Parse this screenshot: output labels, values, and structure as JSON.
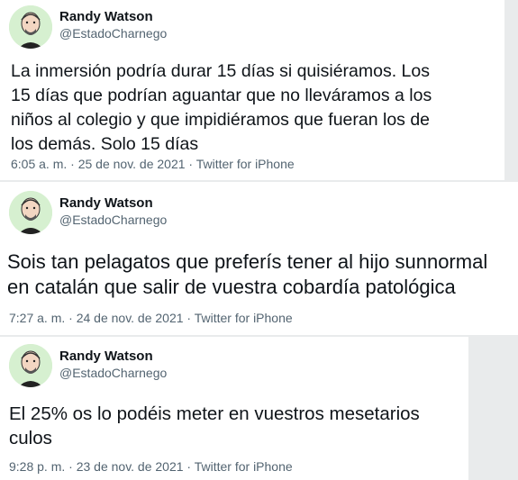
{
  "tweets": [
    {
      "author_name": "Randy Watson",
      "handle": "@EstadoCharnego",
      "text": "La inmersión podría durar 15 días si quisiéramos. Los\n15 días que podrían aguantar que no lleváramos a los\nniños al colegio y que impidiéramos que fueran los de\nlos demás. Solo 15 días",
      "meta": "6:05 a. m. · 25 de nov. de 2021 · Twitter for iPhone"
    },
    {
      "author_name": "Randy Watson",
      "handle": "@EstadoCharnego",
      "text": "Sois tan pelagatos que preferís tener al hijo sunnormal\nen catalán que salir de vuestra cobardía patológica",
      "meta": "7:27 a. m. · 24 de nov. de 2021 · Twitter for iPhone"
    },
    {
      "author_name": "Randy Watson",
      "handle": "@EstadoCharnego",
      "text": "El 25% os lo podéis meter en vuestros mesetarios\nculos",
      "meta": "9:28 p. m. · 23 de nov. de 2021 · Twitter for iPhone"
    }
  ],
  "avatar_icon": "cartoon-man-avatar",
  "colors": {
    "background": "#e9ebec",
    "card": "#ffffff",
    "text_primary": "#0f1419",
    "text_secondary": "#536471",
    "avatar_bg": "#d6f0d0"
  }
}
